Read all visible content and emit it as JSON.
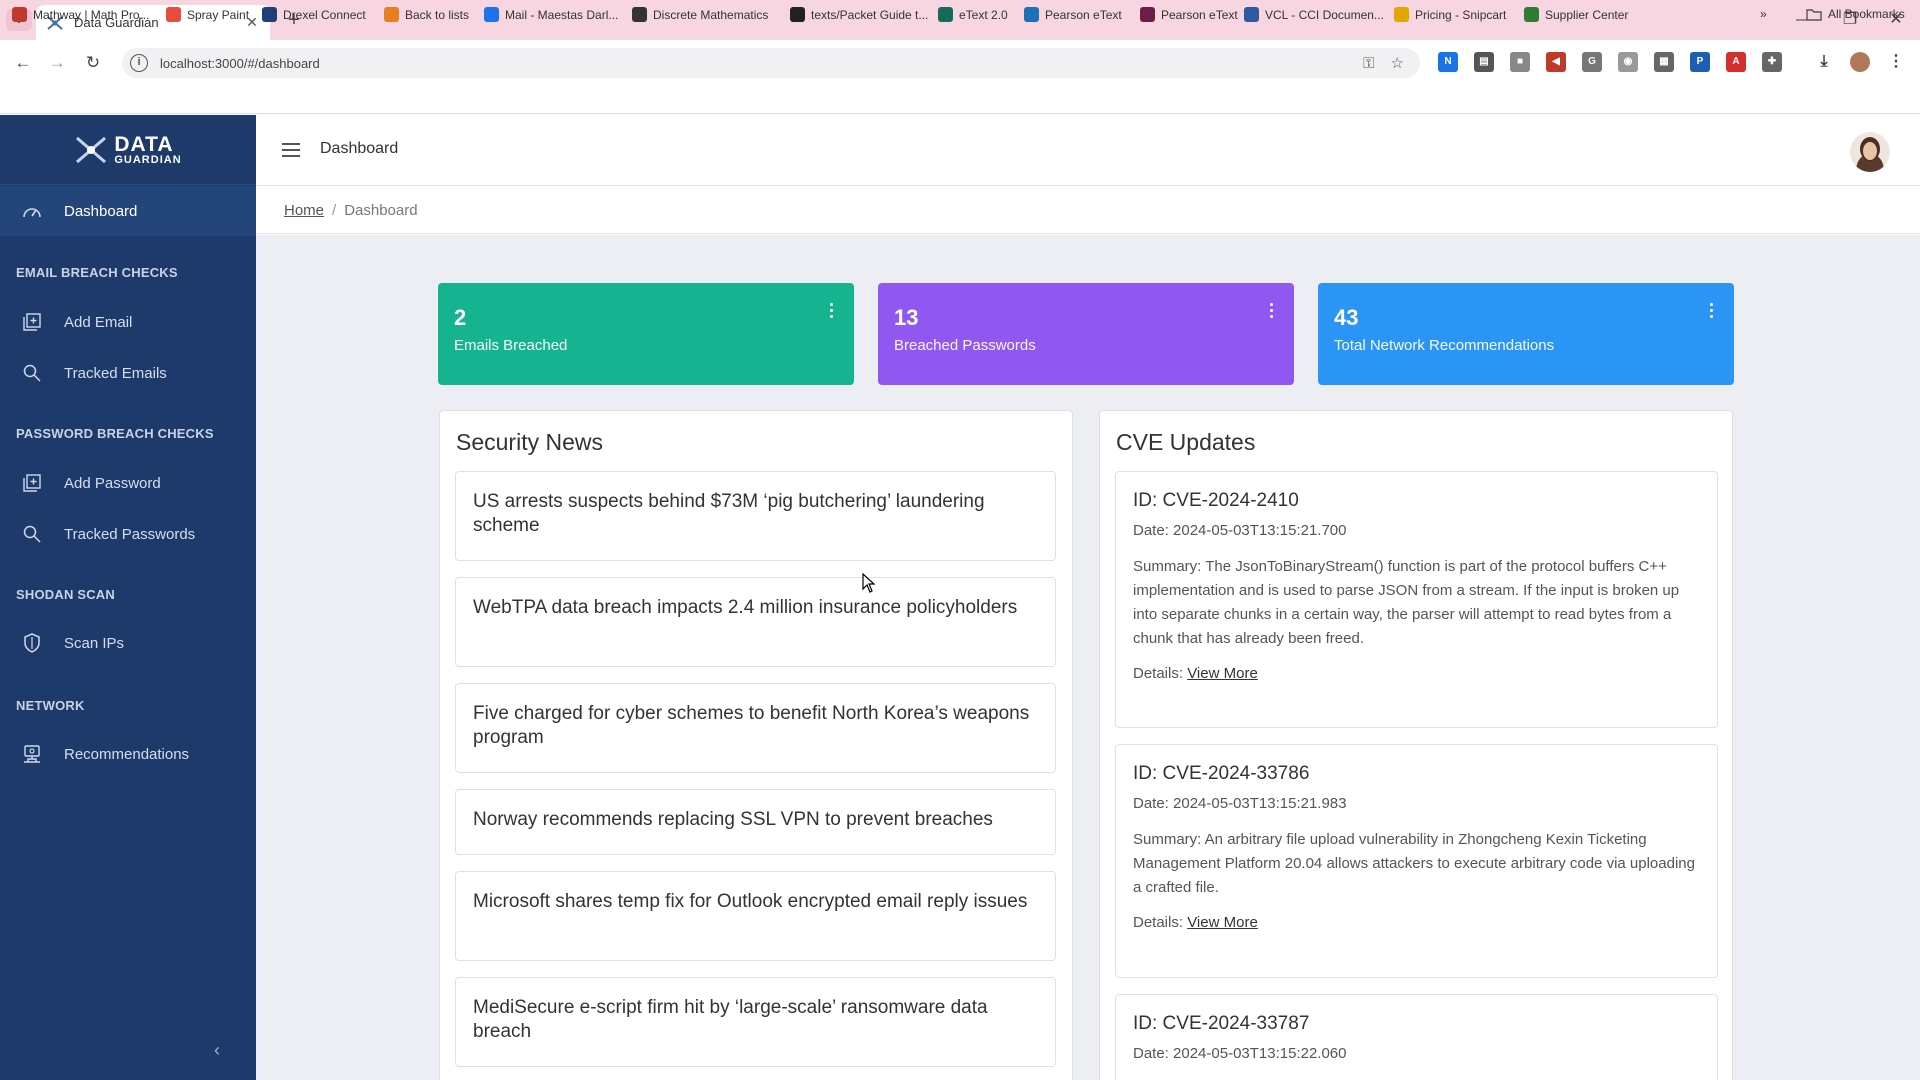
{
  "browser": {
    "tab_title": "Data Guardian",
    "url": "localhost:3000/#/dashboard",
    "bookmarks": [
      {
        "label": "Mathway | Math Pro...",
        "color": "#c0392b"
      },
      {
        "label": "Spray Paint",
        "color": "#e74c3c"
      },
      {
        "label": "Drexel Connect",
        "color": "#1f3f7a"
      },
      {
        "label": "Back to lists",
        "color": "#e67e22"
      },
      {
        "label": "Mail - Maestas Darl...",
        "color": "#1a73e8"
      },
      {
        "label": "Discrete Mathematics",
        "color": "#333333"
      },
      {
        "label": "texts/Packet Guide t...",
        "color": "#222222"
      },
      {
        "label": "eText 2.0",
        "color": "#146b5a"
      },
      {
        "label": "Pearson eText",
        "color": "#1e6fb8"
      },
      {
        "label": "Pearson eText",
        "color": "#6b1e4a"
      },
      {
        "label": "VCL - CCI Documen...",
        "color": "#2d5aa0"
      },
      {
        "label": "Pricing - Snipcart",
        "color": "#e0a800"
      },
      {
        "label": "Supplier Center",
        "color": "#2e7d32"
      }
    ],
    "more_bookmarks": "»",
    "all_bookmarks": "All Bookmarks"
  },
  "sidebar": {
    "brand_line1": "DATA",
    "brand_line2": "GUARDIAN",
    "dashboard": "Dashboard",
    "sections": [
      {
        "heading": "EMAIL BREACH CHECKS",
        "items": [
          {
            "label": "Add Email",
            "icon": "add-box-icon"
          },
          {
            "label": "Tracked Emails",
            "icon": "search-icon"
          }
        ]
      },
      {
        "heading": "PASSWORD BREACH CHECKS",
        "items": [
          {
            "label": "Add Password",
            "icon": "add-box-icon"
          },
          {
            "label": "Tracked Passwords",
            "icon": "search-icon"
          }
        ]
      },
      {
        "heading": "SHODAN SCAN",
        "items": [
          {
            "label": "Scan IPs",
            "icon": "shield-icon"
          }
        ]
      },
      {
        "heading": "NETWORK",
        "items": [
          {
            "label": "Recommendations",
            "icon": "network-icon"
          }
        ]
      }
    ],
    "collapse": "‹"
  },
  "header": {
    "title": "Dashboard"
  },
  "breadcrumb": {
    "home": "Home",
    "separator": "/",
    "current": "Dashboard"
  },
  "stats": [
    {
      "value": "2",
      "label": "Emails Breached",
      "color": "#16b390"
    },
    {
      "value": "13",
      "label": "Breached Passwords",
      "color": "#9058f0"
    },
    {
      "value": "43",
      "label": "Total Network Recommendations",
      "color": "#2b95f5"
    }
  ],
  "news": {
    "title": "Security News",
    "items": [
      "US arrests suspects behind $73M ‘pig butchering’ laundering scheme",
      "WebTPA data breach impacts 2.4 million insurance policyholders",
      "Five charged for cyber schemes to benefit North Korea’s weapons program",
      "Norway recommends replacing SSL VPN to prevent breaches",
      "Microsoft shares temp fix for Outlook encrypted email reply issues",
      "MediSecure e-script firm hit by ‘large-scale’ ransomware data breach"
    ]
  },
  "cve": {
    "title": "CVE Updates",
    "details_label": "Details:",
    "link_label": "View More",
    "items": [
      {
        "id": "ID: CVE-2024-2410",
        "date": "Date: 2024-05-03T13:15:21.700",
        "summary": "Summary: The JsonToBinaryStream() function is part of the protocol buffers C++ implementation and is used to parse JSON from a stream. If the input is broken up into separate chunks in a certain way, the parser will attempt to read bytes from a chunk that has already been freed."
      },
      {
        "id": "ID: CVE-2024-33786",
        "date": "Date: 2024-05-03T13:15:21.983",
        "summary": "Summary: An arbitrary file upload vulnerability in Zhongcheng Kexin Ticketing Management Platform 20.04 allows attackers to execute arbitrary code via uploading a crafted file."
      },
      {
        "id": "ID: CVE-2024-33787",
        "date": "Date: 2024-05-03T13:15:22.060"
      }
    ]
  }
}
